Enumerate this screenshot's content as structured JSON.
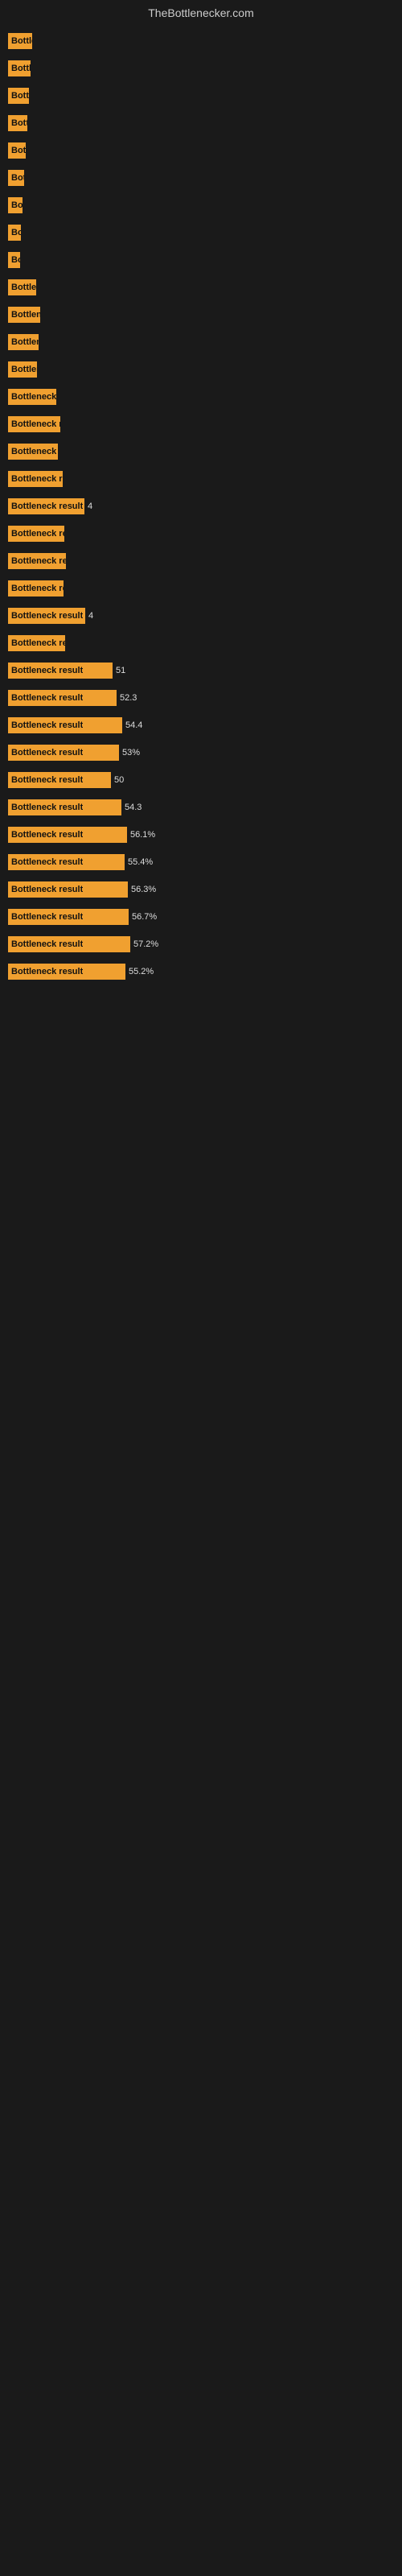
{
  "header": {
    "title": "TheBottlenecker.com"
  },
  "bars": [
    {
      "label": "Bottleneck resu",
      "value": "",
      "width": 30
    },
    {
      "label": "Bottleneck resu",
      "value": "",
      "width": 28
    },
    {
      "label": "Bottleneck resu",
      "value": "",
      "width": 26
    },
    {
      "label": "Bottleneck resu",
      "value": "",
      "width": 24
    },
    {
      "label": "Bottleneck resu",
      "value": "",
      "width": 22
    },
    {
      "label": "Bottleneck resu",
      "value": "",
      "width": 20
    },
    {
      "label": "Bottleneck resu",
      "value": "",
      "width": 18
    },
    {
      "label": "Bottleneck resu",
      "value": "",
      "width": 16
    },
    {
      "label": "Bottleneck resu",
      "value": "",
      "width": 15
    },
    {
      "label": "Bottleneck result",
      "value": "",
      "width": 35
    },
    {
      "label": "Bottleneck result",
      "value": "",
      "width": 40
    },
    {
      "label": "Bottleneck result",
      "value": "",
      "width": 38
    },
    {
      "label": "Bottleneck result",
      "value": "",
      "width": 36
    },
    {
      "label": "Bottleneck result",
      "value": "",
      "width": 60
    },
    {
      "label": "Bottleneck result",
      "value": "",
      "width": 65
    },
    {
      "label": "Bottleneck result",
      "value": "",
      "width": 62
    },
    {
      "label": "Bottleneck result",
      "value": "",
      "width": 68
    },
    {
      "label": "Bottleneck result",
      "value": "4",
      "width": 95
    },
    {
      "label": "Bottleneck result",
      "value": "",
      "width": 70
    },
    {
      "label": "Bottleneck result",
      "value": "",
      "width": 72
    },
    {
      "label": "Bottleneck result",
      "value": "",
      "width": 69
    },
    {
      "label": "Bottleneck result",
      "value": "4",
      "width": 96
    },
    {
      "label": "Bottleneck result",
      "value": "",
      "width": 71
    },
    {
      "label": "Bottleneck result",
      "value": "51",
      "width": 130
    },
    {
      "label": "Bottleneck result",
      "value": "52.3",
      "width": 135
    },
    {
      "label": "Bottleneck result",
      "value": "54.4",
      "width": 142
    },
    {
      "label": "Bottleneck result",
      "value": "53%",
      "width": 138
    },
    {
      "label": "Bottleneck result",
      "value": "50",
      "width": 128
    },
    {
      "label": "Bottleneck result",
      "value": "54.3",
      "width": 141
    },
    {
      "label": "Bottleneck result",
      "value": "56.1%",
      "width": 148
    },
    {
      "label": "Bottleneck result",
      "value": "55.4%",
      "width": 145
    },
    {
      "label": "Bottleneck result",
      "value": "56.3%",
      "width": 149
    },
    {
      "label": "Bottleneck result",
      "value": "56.7%",
      "width": 150
    },
    {
      "label": "Bottleneck result",
      "value": "57.2%",
      "width": 152
    },
    {
      "label": "Bottleneck result",
      "value": "55.2%",
      "width": 146
    }
  ],
  "colors": {
    "bar": "#f0a030",
    "background": "#1a1a1a",
    "text_dark": "#111",
    "text_light": "#ddd",
    "header": "#cccccc"
  }
}
